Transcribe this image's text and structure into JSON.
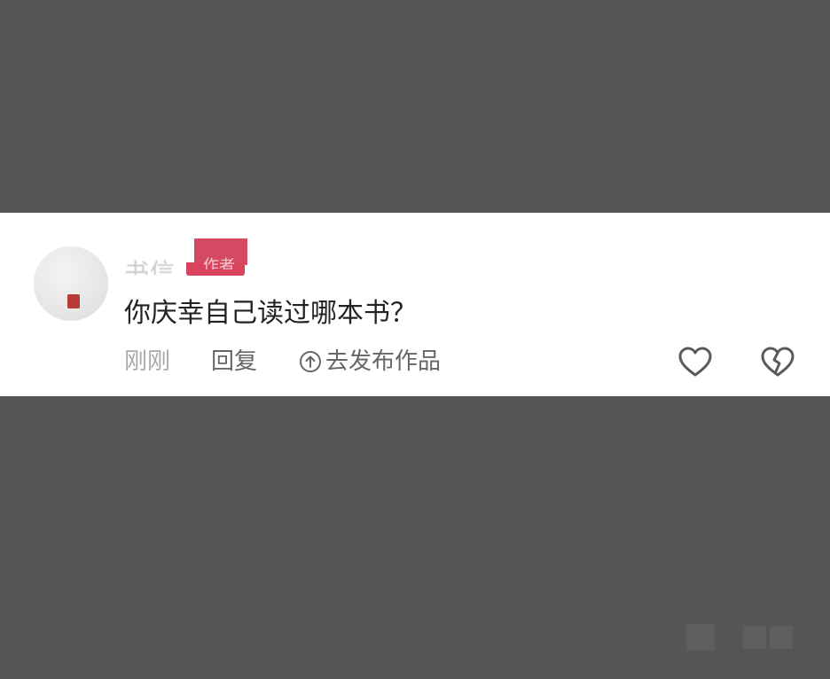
{
  "comment": {
    "username": "书信",
    "author_badge": "作者",
    "text": "你庆幸自己读过哪本书？",
    "time": "刚刚",
    "reply_label": "回复",
    "publish_label": "去发布作品"
  },
  "icons": {
    "avatar": "avatar",
    "seal": "red-seal-icon",
    "publish": "up-arrow-circle-icon",
    "like": "heart-outline-icon",
    "dislike": "broken-heart-icon"
  },
  "colors": {
    "background": "#555555",
    "card": "#ffffff",
    "badge": "#d54a63",
    "text": "#222222",
    "meta": "#a9a9a9",
    "action": "#666666",
    "icon": "#5a5a5a"
  }
}
